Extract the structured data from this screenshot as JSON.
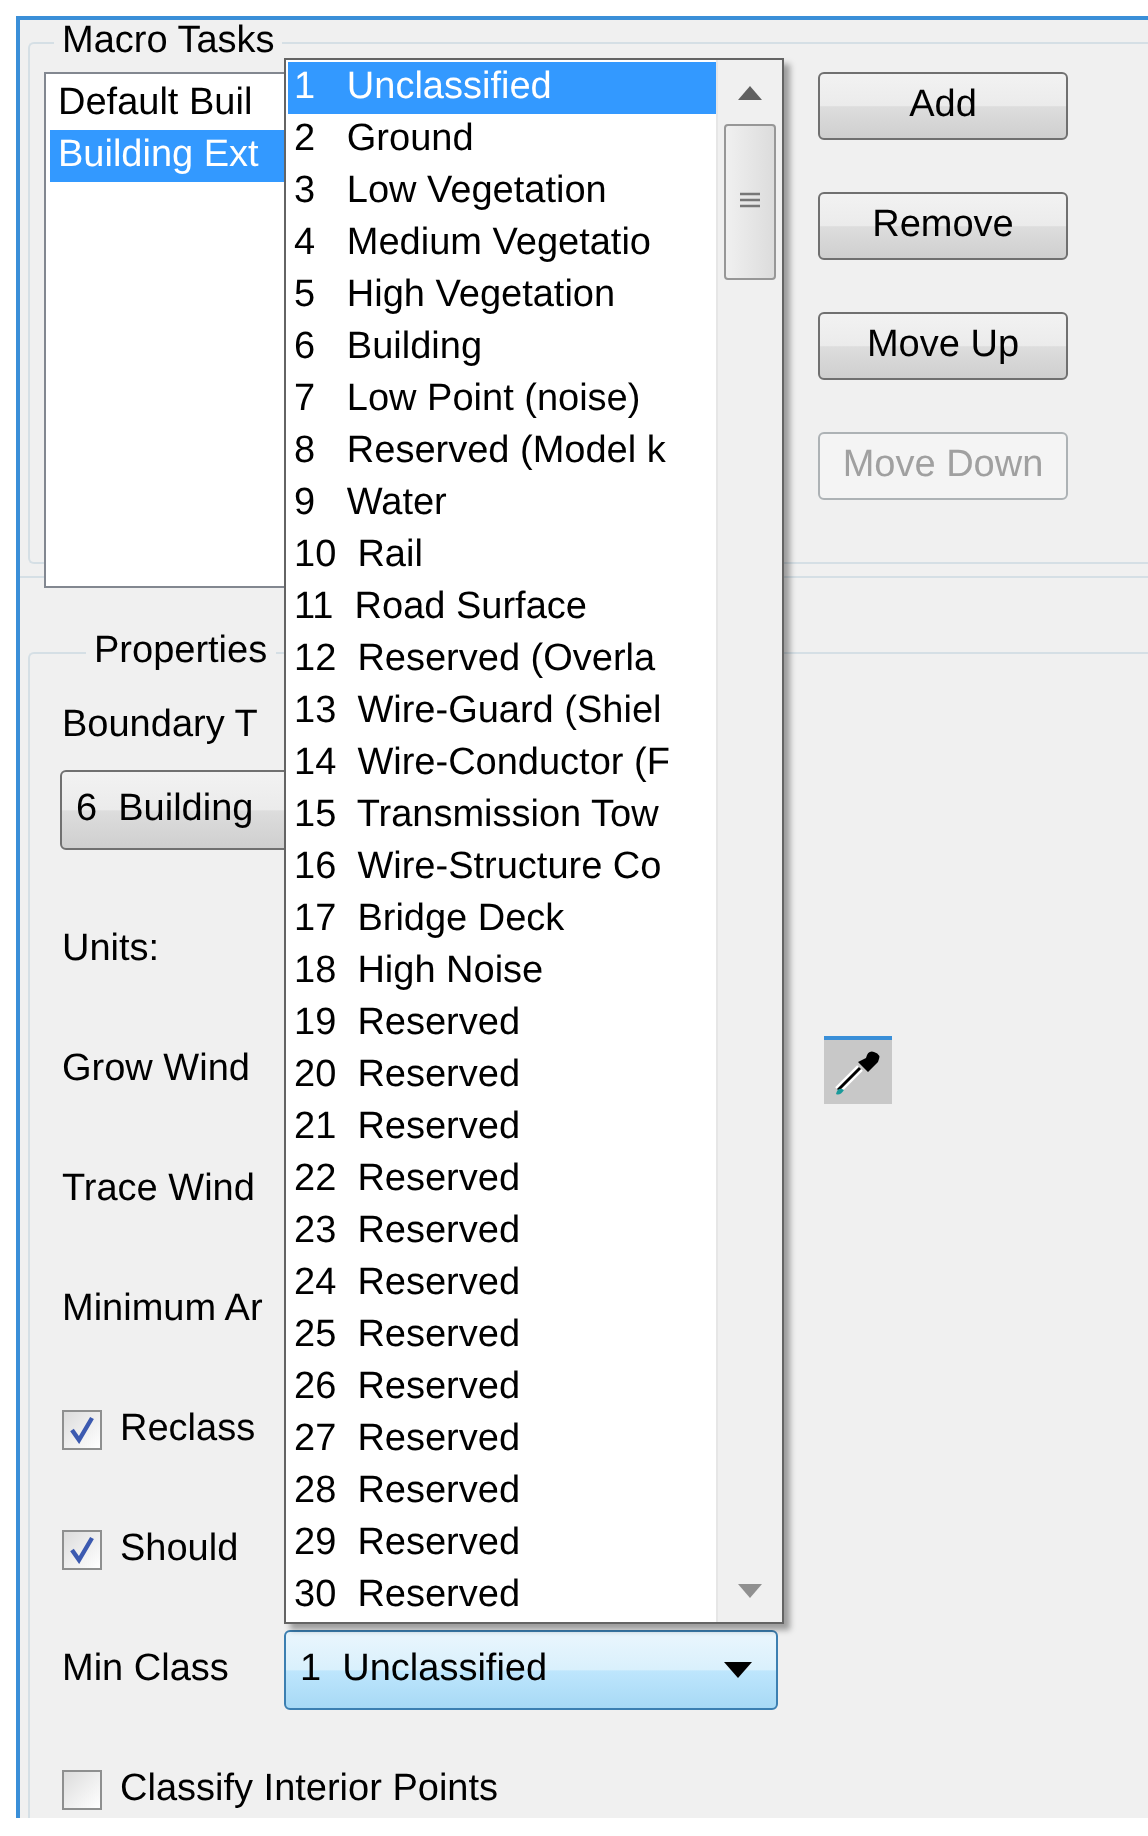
{
  "macro_tasks": {
    "title": "Macro Tasks",
    "items": [
      {
        "label": "Default Buil",
        "selected": false
      },
      {
        "label": "Building Ext",
        "selected": true
      }
    ]
  },
  "buttons": [
    {
      "label": "Add",
      "disabled": false
    },
    {
      "label": "Remove",
      "disabled": false
    },
    {
      "label": "Move Up",
      "disabled": false
    },
    {
      "label": "Move Down",
      "disabled": true
    }
  ],
  "properties": {
    "title": "Properties",
    "boundary_label": "Boundary T",
    "boundary_value": "6  Building",
    "units_label": "Units:",
    "grow_window_label": "Grow Wind",
    "trace_window_label": "Trace Wind",
    "minimum_area_label": "Minimum Ar",
    "checkboxes": [
      {
        "label": "Reclass",
        "checked": true
      },
      {
        "label": "Should",
        "checked": true
      }
    ],
    "min_class_label": "Min Class",
    "min_class_value": "1  Unclassified",
    "classify_interior": {
      "label": "Classify Interior Points",
      "checked": false
    }
  },
  "dropdown": {
    "items": [
      {
        "text": "1   Unclassified",
        "selected": true
      },
      {
        "text": "2   Ground",
        "selected": false
      },
      {
        "text": "3   Low Vegetation",
        "selected": false
      },
      {
        "text": "4   Medium Vegetatio",
        "selected": false
      },
      {
        "text": "5   High Vegetation",
        "selected": false
      },
      {
        "text": "6   Building",
        "selected": false
      },
      {
        "text": "7   Low Point (noise)",
        "selected": false
      },
      {
        "text": "8   Reserved (Model k",
        "selected": false
      },
      {
        "text": "9   Water",
        "selected": false
      },
      {
        "text": "10  Rail",
        "selected": false
      },
      {
        "text": "11  Road Surface",
        "selected": false
      },
      {
        "text": "12  Reserved (Overla",
        "selected": false
      },
      {
        "text": "13  Wire-Guard (Shiel",
        "selected": false
      },
      {
        "text": "14  Wire-Conductor (F",
        "selected": false
      },
      {
        "text": "15  Transmission Tow",
        "selected": false
      },
      {
        "text": "16  Wire-Structure Co",
        "selected": false
      },
      {
        "text": "17  Bridge Deck",
        "selected": false
      },
      {
        "text": "18  High Noise",
        "selected": false
      },
      {
        "text": "19  Reserved",
        "selected": false
      },
      {
        "text": "20  Reserved",
        "selected": false
      },
      {
        "text": "21  Reserved",
        "selected": false
      },
      {
        "text": "22  Reserved",
        "selected": false
      },
      {
        "text": "23  Reserved",
        "selected": false
      },
      {
        "text": "24  Reserved",
        "selected": false
      },
      {
        "text": "25  Reserved",
        "selected": false
      },
      {
        "text": "26  Reserved",
        "selected": false
      },
      {
        "text": "27  Reserved",
        "selected": false
      },
      {
        "text": "28  Reserved",
        "selected": false
      },
      {
        "text": "29  Reserved",
        "selected": false
      },
      {
        "text": "30  Reserved",
        "selected": false
      }
    ]
  }
}
